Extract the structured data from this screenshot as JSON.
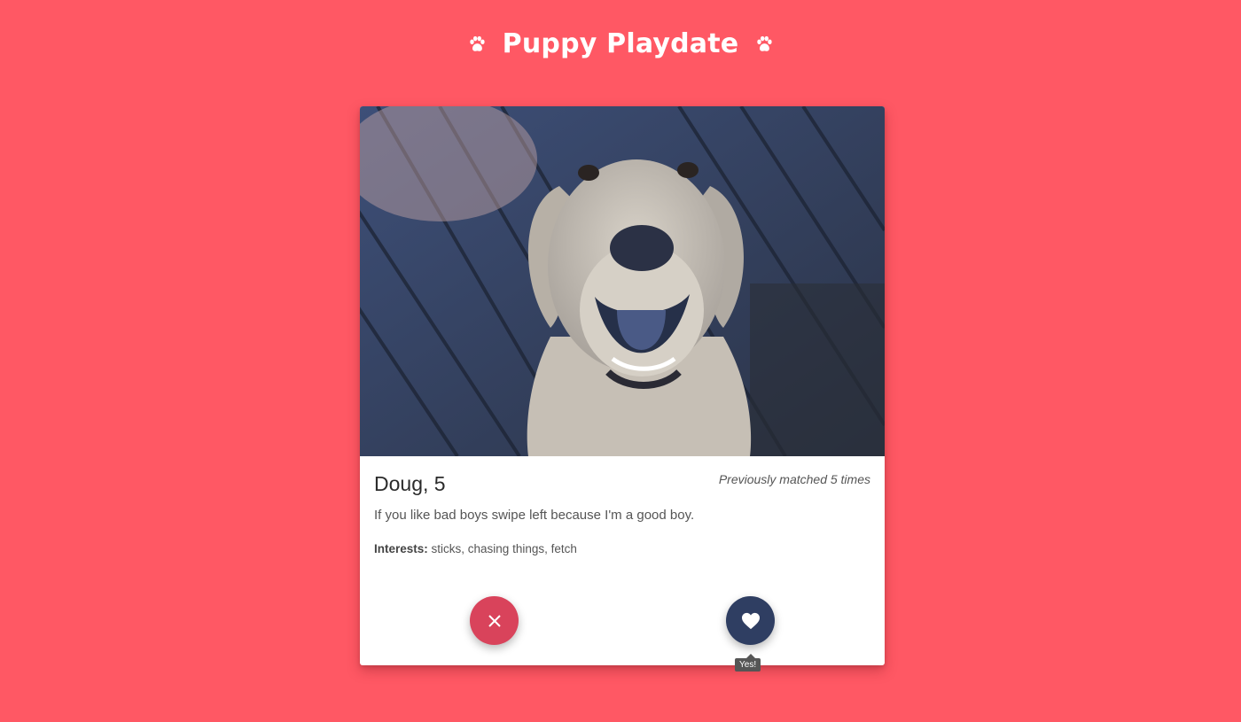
{
  "app": {
    "title": "Puppy Playdate",
    "brand_color": "#ff5864",
    "header_icon": "paw-icon"
  },
  "profile": {
    "name_age": "Doug, 5",
    "matched_text": "Previously matched 5 times",
    "bio": "If you like bad boys swipe left because I'm a good boy.",
    "interests_label": "Interests:",
    "interests_value": " sticks, chasing things, fetch",
    "photo_subject": "dog-photo"
  },
  "actions": {
    "reject_icon": "close-icon",
    "reject_color": "#d9435b",
    "like_icon": "heart-icon",
    "like_color": "#2f3e62",
    "like_tooltip": "Yes!"
  }
}
